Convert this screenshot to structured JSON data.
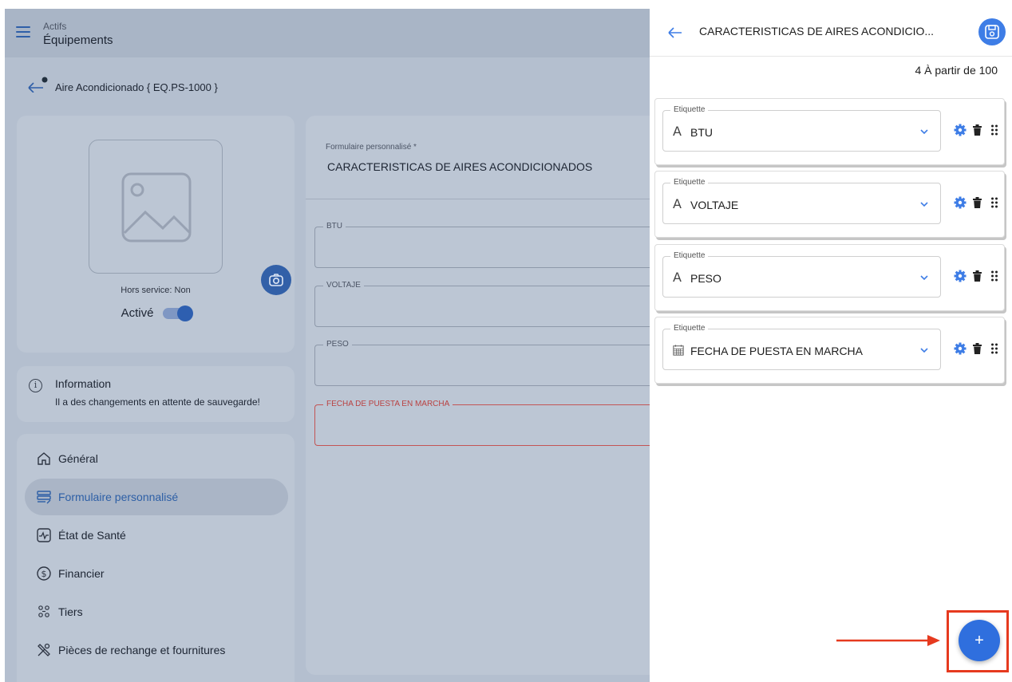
{
  "topbar": {
    "breadcrumb_parent": "Actifs",
    "title": "Équipements"
  },
  "asset": {
    "title": "Aire Acondicionado { EQ.PS-1000 }",
    "out_of_service": "Hors service: Non",
    "active_label": "Activé",
    "active_on": true
  },
  "info": {
    "title": "Information",
    "text": "Il a des changements en attente de sauvegarde!"
  },
  "nav": {
    "items": [
      {
        "label": "Général",
        "icon": "home-icon"
      },
      {
        "label": "Formulaire personnalisé",
        "icon": "form-icon",
        "active": true
      },
      {
        "label": "État de Santé",
        "icon": "health-icon"
      },
      {
        "label": "Financier",
        "icon": "dollar-icon"
      },
      {
        "label": "Tiers",
        "icon": "people-icon"
      },
      {
        "label": "Pièces de rechange et fournitures",
        "icon": "tools-icon"
      }
    ]
  },
  "form": {
    "custom_form_label": "Formulaire personnalisé *",
    "custom_form_value": "CARACTERISTICAS DE AIRES ACONDICIONADOS",
    "fields": [
      {
        "label": "BTU",
        "value": ""
      },
      {
        "label": "VOLTAJE",
        "value": ""
      },
      {
        "label": "PESO",
        "value": ""
      },
      {
        "label": "FECHA DE PUESTA EN MARCHA",
        "value": "",
        "error": true
      }
    ]
  },
  "panel": {
    "title": "CARACTERISTICAS DE AIRES ACONDICIO...",
    "count_text": "4 À partir de 100",
    "label_legend": "Etiquette",
    "labels": [
      {
        "text": "BTU",
        "type_icon": "text-type-icon",
        "glyph": "A"
      },
      {
        "text": "VOLTAJE",
        "type_icon": "text-type-icon",
        "glyph": "A"
      },
      {
        "text": "PESO",
        "type_icon": "text-type-icon",
        "glyph": "A"
      },
      {
        "text": "FECHA DE PUESTA EN MARCHA",
        "type_icon": "calendar-icon",
        "glyph": "calendar"
      }
    ],
    "fab_label": "+"
  },
  "colors": {
    "accent": "#3e7de6",
    "annotation": "#e63a1f",
    "error": "#c35454"
  }
}
